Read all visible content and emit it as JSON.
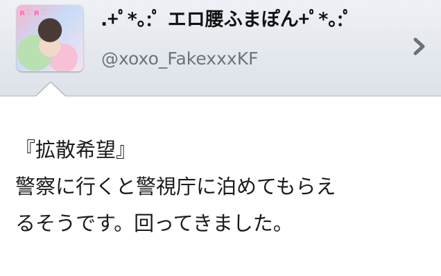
{
  "profile": {
    "display_name": ".+ﾟ*｡:ﾟ エロ腰ふまぽん+ﾟ*｡:ﾟ",
    "handle": "@xoxo_FakexxxKF",
    "avatar_text": "ฅ♡ฅ♡"
  },
  "tweet": {
    "lines": [
      "『拡散希望』",
      "警察に行くと警視庁に泊めてもらえ",
      "るそうです。回ってきました。"
    ]
  },
  "icons": {
    "chevron": "chevron-right-icon"
  },
  "colors": {
    "header_bg": "#e4e8ee",
    "handle_gray": "#6e7378",
    "chevron_gray": "#6b7076"
  }
}
